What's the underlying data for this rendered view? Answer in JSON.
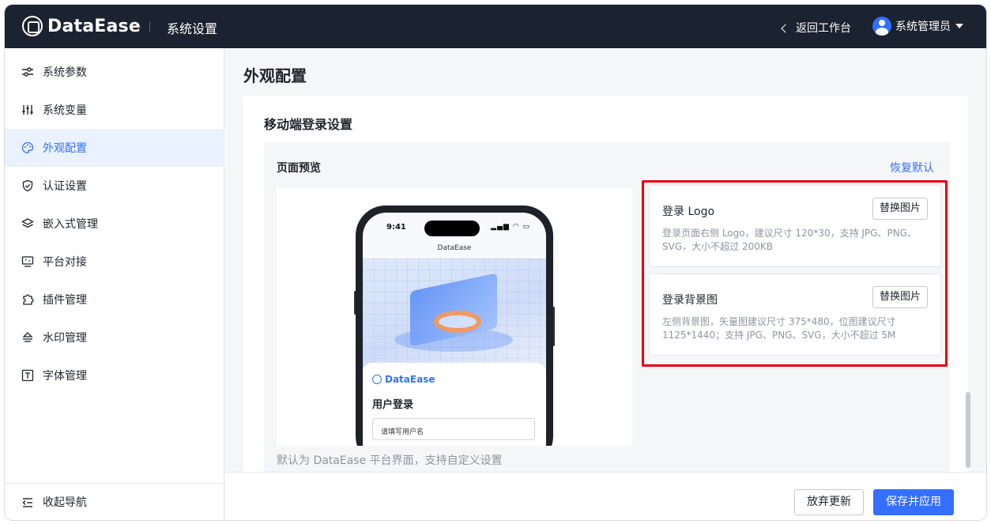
{
  "header": {
    "brand": "DataEase",
    "section_title": "系统设置",
    "back_label": "返回工作台",
    "user_name": "系统管理员",
    "colors": {
      "header_bg": "#1b2230",
      "accent": "#3370ff"
    }
  },
  "sidebar": {
    "items": [
      {
        "label": "系统参数",
        "icon": "sliders-icon",
        "active": false
      },
      {
        "label": "系统变量",
        "icon": "equalizer-icon",
        "active": false
      },
      {
        "label": "外观配置",
        "icon": "palette-icon",
        "active": true
      },
      {
        "label": "认证设置",
        "icon": "shield-check-icon",
        "active": false
      },
      {
        "label": "嵌入式管理",
        "icon": "layers-icon",
        "active": false
      },
      {
        "label": "平台对接",
        "icon": "monitor-icon",
        "active": false
      },
      {
        "label": "插件管理",
        "icon": "puzzle-icon",
        "active": false
      },
      {
        "label": "水印管理",
        "icon": "watermark-icon",
        "active": false
      },
      {
        "label": "字体管理",
        "icon": "text-box-icon",
        "active": false
      }
    ],
    "collapse_label": "收起导航"
  },
  "main": {
    "page_title": "外观配置",
    "card_title": "移动端登录设置",
    "preview_label": "页面预览",
    "restore_default": "恢复默认",
    "hint": "默认为 DataEase 平台界面，支持自定义设置",
    "phone": {
      "time": "9:41",
      "app_title": "DataEase",
      "brand": "DataEase",
      "login_title": "用户登录",
      "username_placeholder": "请填写用户名"
    },
    "settings": [
      {
        "title": "登录 Logo",
        "button": "替换图片",
        "desc": "登录页面右侧 Logo，建议尺寸 120*30，支持 JPG、PNG、SVG，大小不超过 200KB"
      },
      {
        "title": "登录背景图",
        "button": "替换图片",
        "desc": "左侧背景图，矢量图建议尺寸 375*480，位图建议尺寸 1125*1440；支持 JPG、PNG、SVG，大小不超过 5M"
      }
    ],
    "highlight_color": "#e60012"
  },
  "footer": {
    "discard_label": "放弃更新",
    "save_label": "保存并应用"
  }
}
